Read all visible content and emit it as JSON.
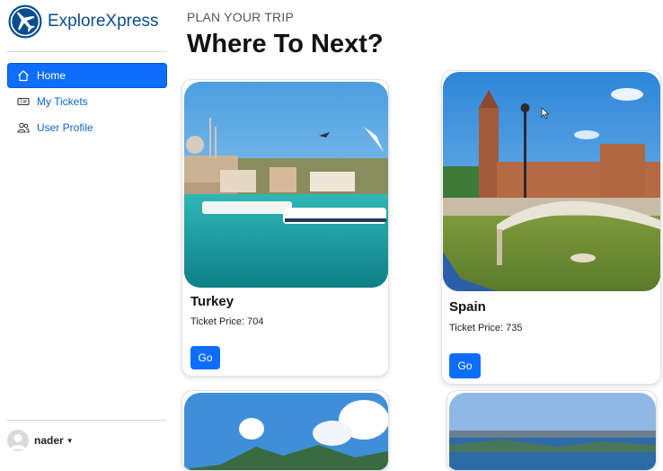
{
  "app": {
    "brand_name": "ExploreXpress"
  },
  "sidebar": {
    "items": [
      {
        "label": "Home",
        "icon": "home-icon",
        "active": true
      },
      {
        "label": "My Tickets",
        "icon": "ticket-icon",
        "active": false
      },
      {
        "label": "User Profile",
        "icon": "users-icon",
        "active": false
      }
    ],
    "user": {
      "name": "nader"
    }
  },
  "main": {
    "kicker": "PLAN YOUR TRIP",
    "title": "Where To Next?",
    "cards": [
      {
        "destination": "Turkey",
        "price_text": "Ticket Price: 704",
        "button_label": "Go"
      },
      {
        "destination": "Spain",
        "price_text": "Ticket Price: 735",
        "button_label": "Go"
      }
    ]
  },
  "colors": {
    "accent": "#0d6efd",
    "brand": "#0b4d8a",
    "link": "#0b63c9"
  }
}
